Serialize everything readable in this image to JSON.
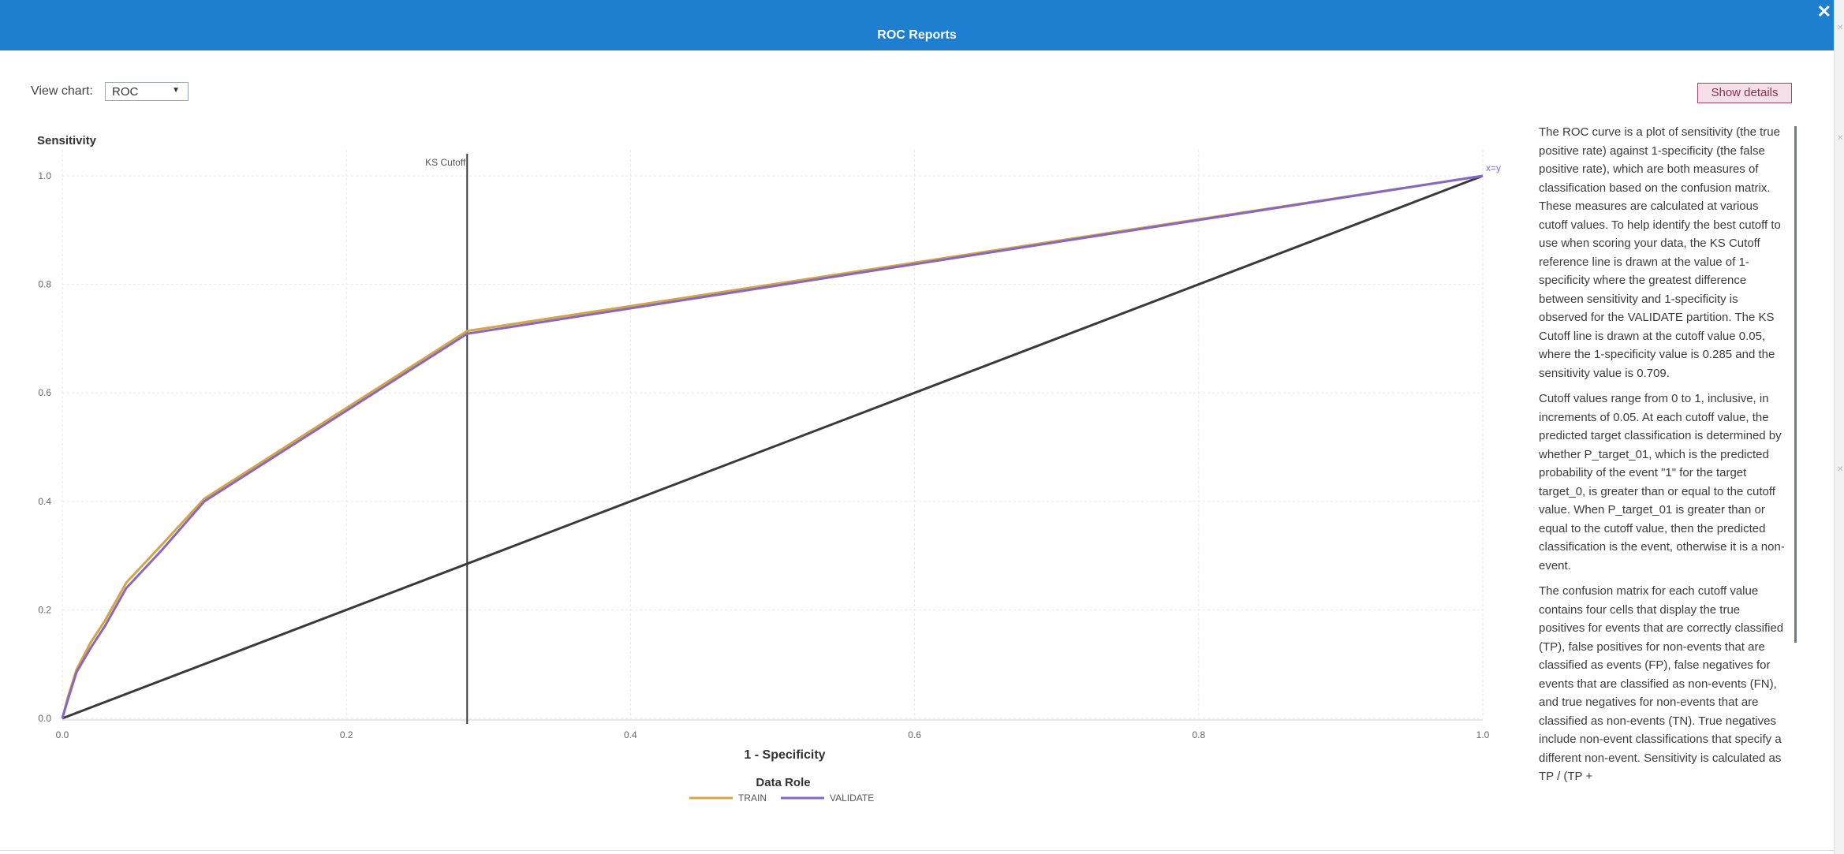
{
  "window": {
    "title": "ROC Reports",
    "close_label": "✕"
  },
  "toolbar": {
    "view_chart_label": "View chart:",
    "view_chart_value": "ROC",
    "dropdown_arrow": "▼",
    "show_details_label": "Show details"
  },
  "colors": {
    "header": "#1e7fd0",
    "train": "#d4a546",
    "validate": "#8468c9",
    "reference": "#3a3a3a"
  },
  "chart_data": {
    "type": "line",
    "ylabel": "Sensitivity",
    "xlabel": "1 - Specificity",
    "xlim": [
      0,
      1
    ],
    "ylim": [
      0,
      1
    ],
    "x_ticks": [
      "0.0",
      "0.2",
      "0.4",
      "0.6",
      "0.8",
      "1.0"
    ],
    "y_ticks": [
      "0.0",
      "0.2",
      "0.4",
      "0.6",
      "0.8",
      "1.0"
    ],
    "grid": true,
    "legend": {
      "title": "Data Role",
      "placement": "bottom"
    },
    "series": [
      {
        "name": "TRAIN",
        "x": [
          0,
          0.004,
          0.01,
          0.02,
          0.03,
          0.045,
          0.07,
          0.1,
          0.285,
          1.0
        ],
        "y": [
          0,
          0.04,
          0.09,
          0.14,
          0.18,
          0.25,
          0.32,
          0.405,
          0.714,
          1.0
        ]
      },
      {
        "name": "VALIDATE",
        "x": [
          0,
          0.004,
          0.01,
          0.02,
          0.03,
          0.045,
          0.07,
          0.1,
          0.285,
          1.0
        ],
        "y": [
          0,
          0.035,
          0.085,
          0.13,
          0.17,
          0.24,
          0.31,
          0.4,
          0.709,
          1.0
        ]
      }
    ],
    "reference_line": {
      "label": "x=y",
      "x": [
        0,
        1
      ],
      "y": [
        0,
        1
      ]
    },
    "ks_cutoff": {
      "label": "KS Cutoff",
      "x": 0.285
    }
  },
  "details": {
    "paragraphs": [
      "The ROC curve is a plot of sensitivity (the true positive rate) against 1-specificity (the false positive rate), which are both measures of classification based on the confusion matrix. These measures are calculated at various cutoff values. To help identify the best cutoff to use when scoring your data, the KS Cutoff reference line is drawn at the value of 1-specificity where the greatest difference between sensitivity and 1-specificity is observed for the VALIDATE partition. The KS Cutoff line is drawn at the cutoff value 0.05, where the 1-specificity value is 0.285 and the sensitivity value is 0.709.",
      "Cutoff values range from 0 to 1, inclusive, in increments of 0.05. At each cutoff value, the predicted target classification is determined by whether P_target_01, which is the predicted probability of the event \"1\" for the target target_0, is greater than or equal to the cutoff value. When P_target_01 is greater than or equal to the cutoff value, then the predicted classification is the event, otherwise it is a non-event.",
      "The confusion matrix for each cutoff value contains four cells that display the true positives for events that are correctly classified (TP), false positives for non-events that are classified as events (FP), false negatives for events that are classified as non-events (FN), and true negatives for non-events that are classified as non-events (TN). True negatives include non-event classifications that specify a different non-event. Sensitivity is calculated as TP / (TP +"
    ]
  }
}
